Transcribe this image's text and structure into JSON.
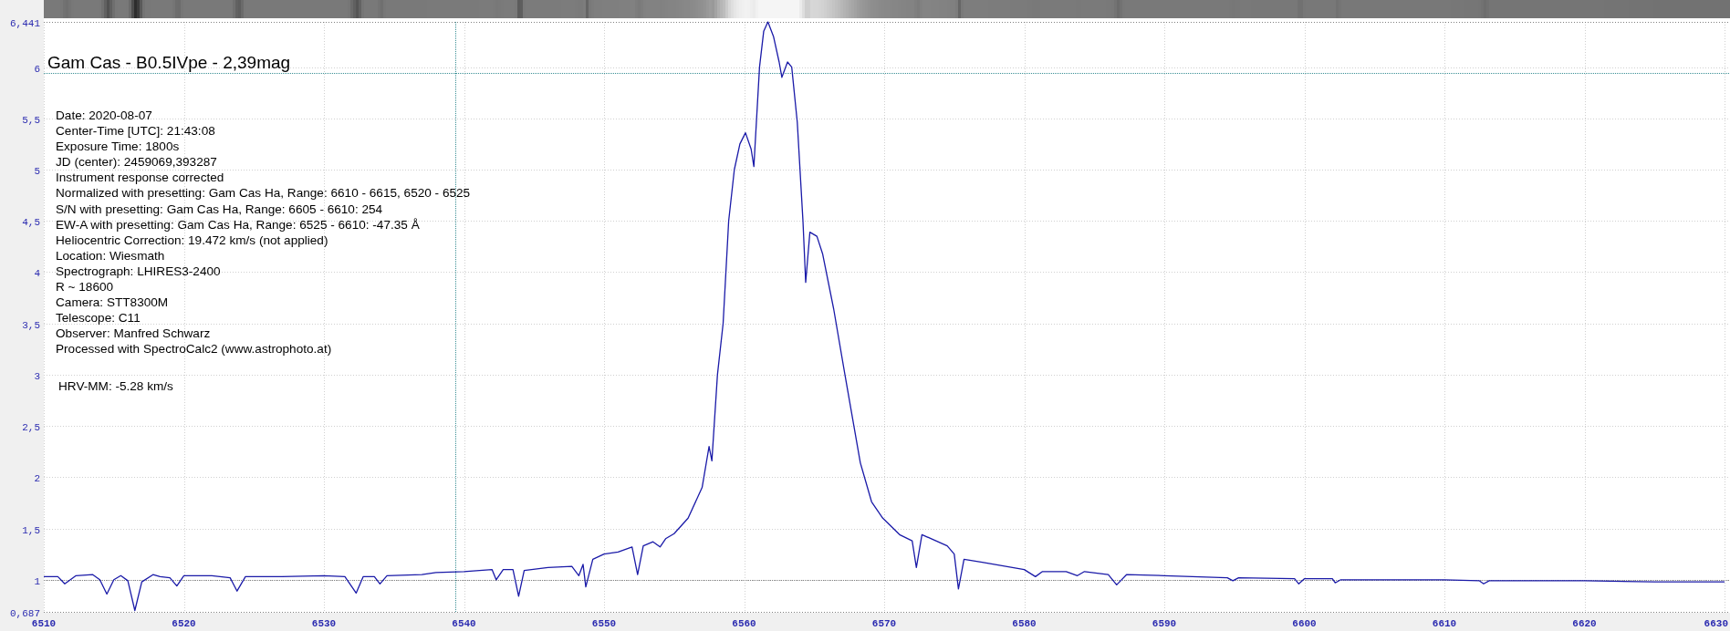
{
  "plot": {
    "chart_data": {
      "type": "line",
      "title": "Gam Cas - B0.5IVpe - 2,39mag",
      "xlim": [
        6510,
        6630
      ],
      "ylim": [
        0.687,
        6.441
      ],
      "xticks": [
        6510,
        6520,
        6530,
        6540,
        6550,
        6560,
        6570,
        6580,
        6590,
        6600,
        6610,
        6620,
        6630
      ],
      "yticks": [
        {
          "value": 0.687,
          "label": "0,687"
        },
        {
          "value": 1,
          "label": "1"
        },
        {
          "value": 1.5,
          "label": "1,5"
        },
        {
          "value": 2,
          "label": "2"
        },
        {
          "value": 2.5,
          "label": "2,5"
        },
        {
          "value": 3,
          "label": "3"
        },
        {
          "value": 3.5,
          "label": "3,5"
        },
        {
          "value": 4,
          "label": "4"
        },
        {
          "value": 4.5,
          "label": "4,5"
        },
        {
          "value": 5,
          "label": "5"
        },
        {
          "value": 5.5,
          "label": "5,5"
        },
        {
          "value": 6,
          "label": "6"
        },
        {
          "value": 6.441,
          "label": "6,441"
        }
      ],
      "x": [
        6510,
        6511,
        6511.5,
        6512.3,
        6513.5,
        6514,
        6514.5,
        6515,
        6515.5,
        6516,
        6516.5,
        6517,
        6517.8,
        6518.3,
        6519,
        6519.5,
        6520,
        6522,
        6523.3,
        6523.8,
        6524.4,
        6527,
        6530,
        6531.5,
        6532.3,
        6532.8,
        6533.6,
        6534,
        6534.5,
        6537,
        6538,
        6540,
        6542,
        6542.3,
        6542.8,
        6543.5,
        6543.9,
        6544.3,
        6546,
        6547.7,
        6548.2,
        6548.5,
        6548.7,
        6549.2,
        6550,
        6551,
        6552,
        6552.4,
        6552.8,
        6553.5,
        6554,
        6554.4,
        6555,
        6556,
        6557,
        6557.5,
        6557.7,
        6558.1,
        6558.5,
        6558.9,
        6559.3,
        6559.7,
        6560.1,
        6560.5,
        6560.7,
        6561.1,
        6561.4,
        6561.7,
        6562.1,
        6562.5,
        6562.7,
        6563.1,
        6563.4,
        6563.8,
        6564.2,
        6564.4,
        6564.7,
        6565.2,
        6565.6,
        6566.4,
        6567.2,
        6568.3,
        6569.1,
        6569.9,
        6571.1,
        6572,
        6572.3,
        6572.7,
        6574.5,
        6575,
        6575.3,
        6575.7,
        6577,
        6580,
        6580.8,
        6581.3,
        6583,
        6583.8,
        6584.3,
        6586,
        6586.6,
        6587.3,
        6590,
        6594.5,
        6594.9,
        6595.3,
        6599.3,
        6599.6,
        6600,
        6602,
        6602.2,
        6602.6,
        6605,
        6610,
        6612.5,
        6612.8,
        6613.2,
        6620,
        6625,
        6630
      ],
      "series": [
        {
          "color": "#1a1aa8",
          "values": [
            1.03,
            1.03,
            0.96,
            1.04,
            1.05,
            1.0,
            0.86,
            1.0,
            1.04,
            0.99,
            0.7,
            0.98,
            1.05,
            1.03,
            1.02,
            0.94,
            1.04,
            1.04,
            1.02,
            0.89,
            1.03,
            1.03,
            1.04,
            1.03,
            0.87,
            1.03,
            1.03,
            0.96,
            1.04,
            1.05,
            1.07,
            1.08,
            1.1,
            1.0,
            1.1,
            1.1,
            0.84,
            1.09,
            1.12,
            1.13,
            1.04,
            1.15,
            0.93,
            1.2,
            1.25,
            1.27,
            1.32,
            1.05,
            1.33,
            1.37,
            1.32,
            1.4,
            1.45,
            1.6,
            1.9,
            2.3,
            2.16,
            3.0,
            3.5,
            4.5,
            5.0,
            5.25,
            5.36,
            5.2,
            5.03,
            6.0,
            6.35,
            6.44,
            6.3,
            6.05,
            5.9,
            6.05,
            6.0,
            5.46,
            4.5,
            3.9,
            4.39,
            4.35,
            4.18,
            3.64,
            3.0,
            2.14,
            1.76,
            1.6,
            1.44,
            1.38,
            1.12,
            1.44,
            1.33,
            1.25,
            0.91,
            1.2,
            1.17,
            1.1,
            1.03,
            1.08,
            1.08,
            1.04,
            1.08,
            1.05,
            0.95,
            1.05,
            1.04,
            1.02,
            0.99,
            1.02,
            1.01,
            0.96,
            1.01,
            1.01,
            0.97,
            1.0,
            1.0,
            1.0,
            0.99,
            0.96,
            0.99,
            0.99,
            0.98,
            0.98
          ]
        }
      ],
      "grid": true,
      "ref_lines": [
        {
          "axis": "x",
          "value": 6539.4,
          "color": "#3a8f95"
        },
        {
          "axis": "y",
          "value": 5.94,
          "color": "#3a8f95"
        },
        {
          "axis": "y",
          "value": 1,
          "color": "#808080"
        }
      ]
    },
    "info_lines": [
      "Date: 2020-08-07",
      "Center-Time [UTC]: 21:43:08",
      "Exposure Time: 1800s",
      "JD (center): 2459069,393287",
      "Instrument response corrected",
      "Normalized with presetting: Gam Cas Ha, Range: 6610 - 6615, 6520 - 6525",
      "S/N with presetting: Gam Cas Ha, Range: 6605 - 6610: 254",
      "EW-A with presetting: Gam Cas Ha, Range: 6525 - 6610: -47.35 Å",
      "Heliocentric Correction: 19.472 km/s (not applied)",
      "Location: Wiesmath",
      "Spectrograph: LHIRES3-2400",
      "R ~ 18600",
      "Camera: STT8300M",
      "Telescope: C11",
      "Observer: Manfred Schwarz",
      "Processed with SpectroCalc2 (www.astrophoto.at)"
    ],
    "hrv": "HRV-MM: -5.28 km/s"
  }
}
